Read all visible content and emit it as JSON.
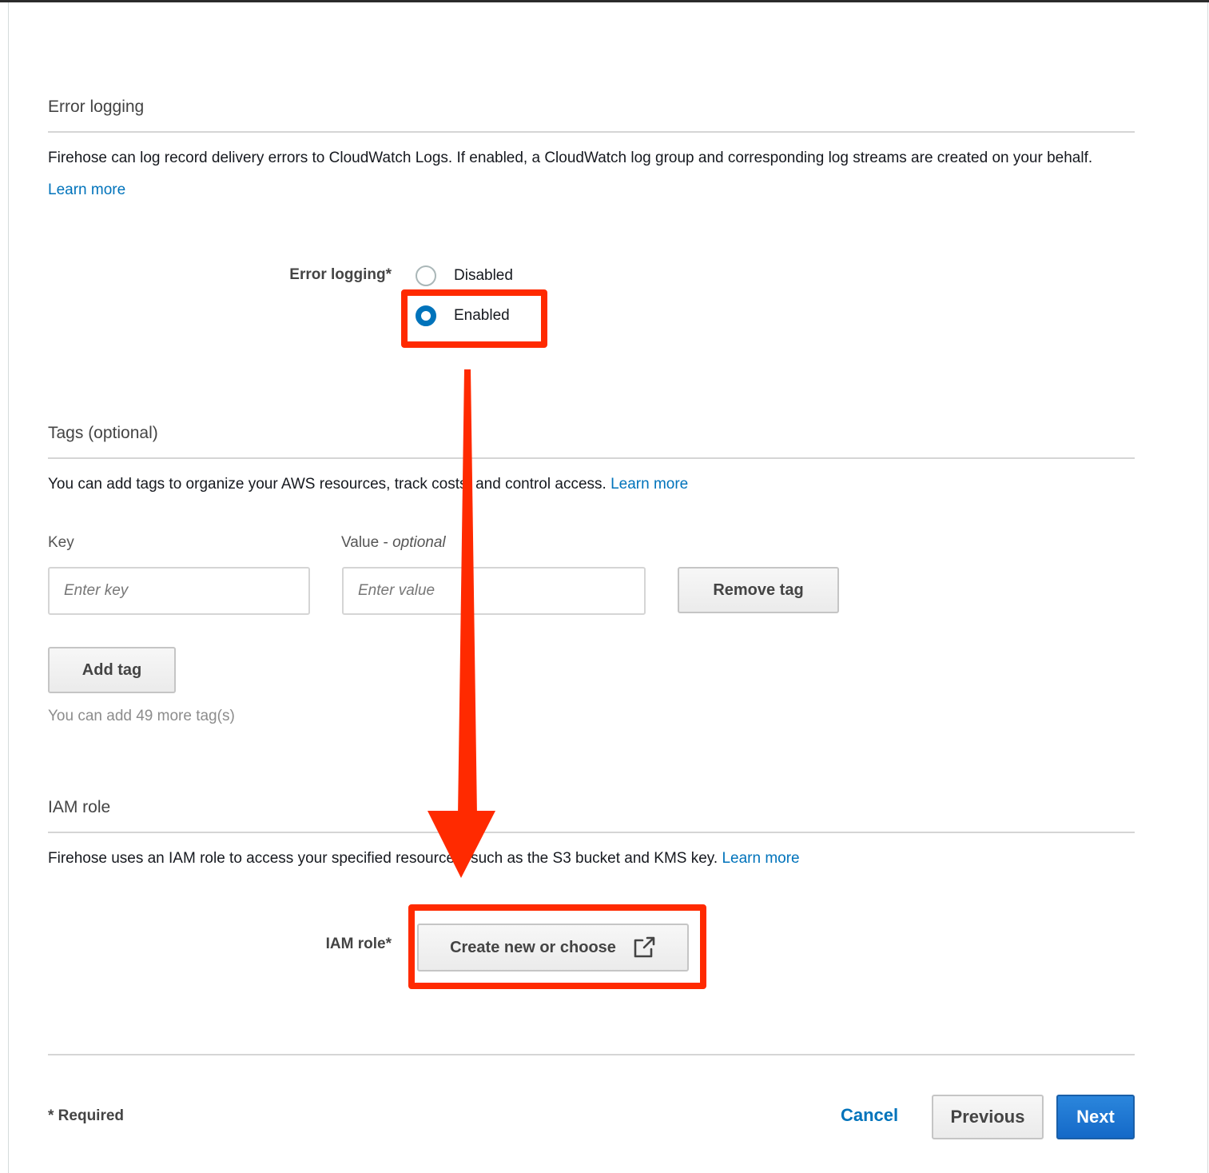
{
  "error_logging": {
    "section_title": "Error logging",
    "description": "Firehose can log record delivery errors to CloudWatch Logs. If enabled, a CloudWatch log group and corresponding log streams are created on your behalf.",
    "learn_more": "Learn more",
    "field_label": "Error logging*",
    "options": [
      {
        "label": "Disabled",
        "selected": false
      },
      {
        "label": "Enabled",
        "selected": true
      }
    ]
  },
  "tags": {
    "section_title": "Tags (optional)",
    "description": "You can add tags to organize your AWS resources, track costs, and control access.",
    "learn_more": "Learn more",
    "key_label": "Key",
    "value_label": "Value - ",
    "value_label_optional": "optional",
    "key_placeholder": "Enter key",
    "value_placeholder": "Enter value",
    "remove_tag": "Remove tag",
    "add_tag": "Add tag",
    "remaining_hint": "You can add 49 more tag(s)"
  },
  "iam_role": {
    "section_title": "IAM role",
    "description": "Firehose uses an IAM role to access your specified resources, such as the S3 bucket and KMS key.",
    "learn_more": "Learn more",
    "field_label": "IAM role*",
    "button_label": "Create new or choose",
    "button_icon": "external-link-icon"
  },
  "footer": {
    "required_note": "* Required",
    "cancel": "Cancel",
    "previous": "Previous",
    "next": "Next"
  },
  "annotations": {
    "highlight_color": "#ff2a00",
    "link_color": "#0073bb",
    "primary_color": "#1469c8"
  }
}
